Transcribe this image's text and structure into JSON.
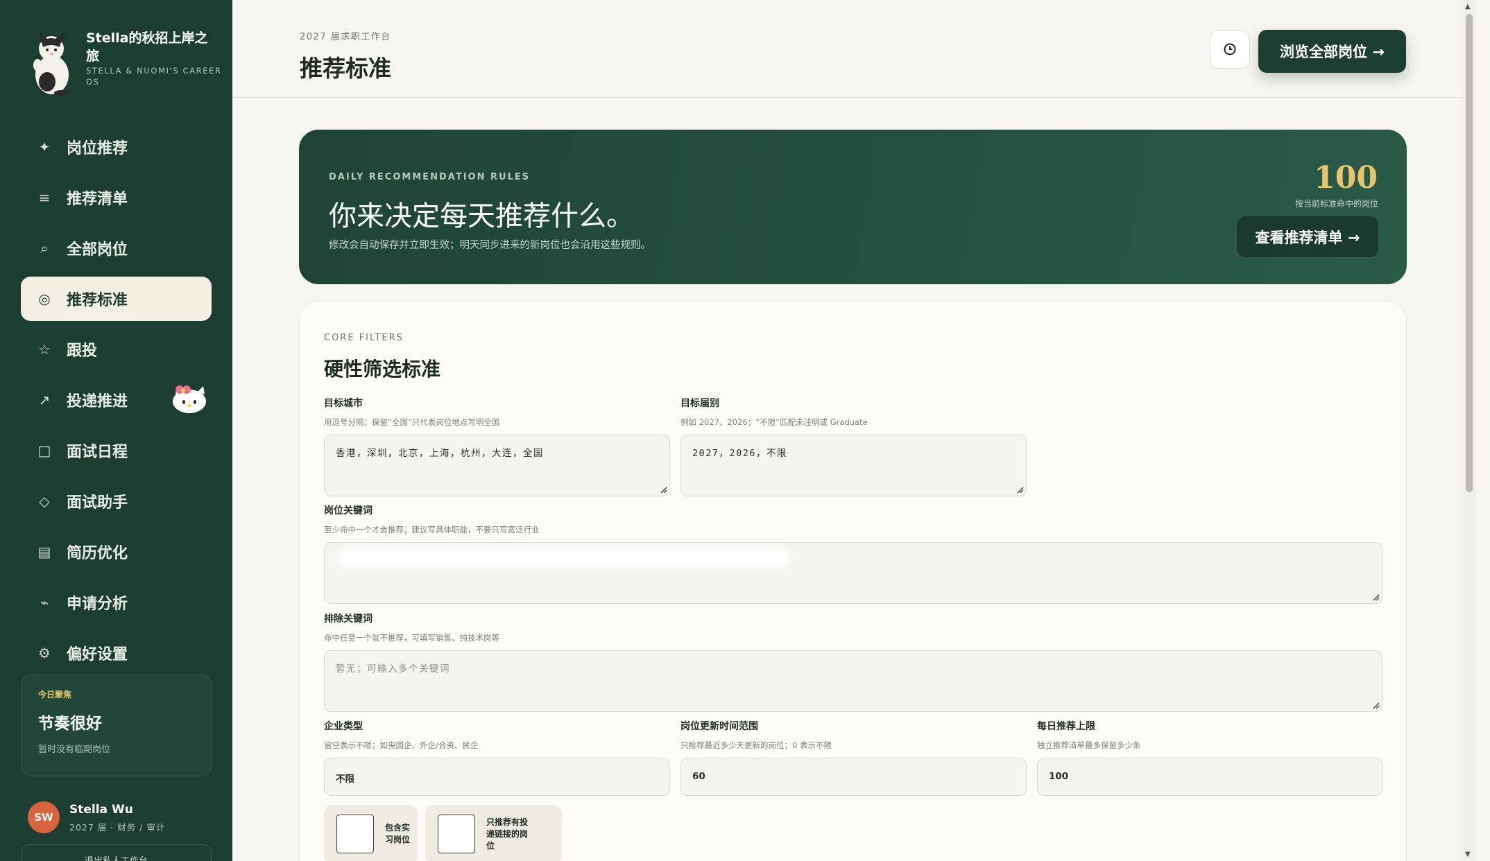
{
  "brand": {
    "title": "Stella的秋招上岸之旅",
    "subtitle": "STELLA & NUOMI'S CAREER OS"
  },
  "nav": [
    {
      "icon": "sparkle-icon",
      "glyph": "✦",
      "label": "岗位推荐"
    },
    {
      "icon": "list-icon",
      "glyph": "≡",
      "label": "推荐清单"
    },
    {
      "icon": "search-icon",
      "glyph": "⌕",
      "label": "全部岗位"
    },
    {
      "icon": "target-icon",
      "glyph": "◎",
      "label": "推荐标准"
    },
    {
      "icon": "star-icon",
      "glyph": "☆",
      "label": "跟投"
    },
    {
      "icon": "arrow-up-right-icon",
      "glyph": "↗",
      "label": "投递推进"
    },
    {
      "icon": "square-icon",
      "glyph": "□",
      "label": "面试日程"
    },
    {
      "icon": "diamond-icon",
      "glyph": "◇",
      "label": "面试助手"
    },
    {
      "icon": "document-icon",
      "glyph": "▤",
      "label": "简历优化"
    },
    {
      "icon": "trend-icon",
      "glyph": "⌁",
      "label": "申请分析"
    },
    {
      "icon": "gear-icon",
      "glyph": "⚙",
      "label": "偏好设置"
    }
  ],
  "focus": {
    "tag": "今日聚焦",
    "title": "节奏很好",
    "subtitle": "暂时没有临期岗位"
  },
  "user": {
    "initials": "SW",
    "name": "Stella Wu",
    "meta": "2027 届 · 财务 / 审计",
    "logout": "退出私人工作台"
  },
  "header": {
    "eyebrow": "2027 届求职工作台",
    "title": "推荐标准",
    "history_icon": "clock-icon",
    "browse_button": "浏览全部岗位 →"
  },
  "hero": {
    "eyebrow": "DAILY RECOMMENDATION RULES",
    "title": "你来决定每天推荐什么。",
    "description": "修改会自动保存并立即生效；明天同步进来的新岗位也会沿用这些规则。",
    "count": "100",
    "count_label": "按当前标准命中的岗位",
    "button": "查看推荐清单 →"
  },
  "filters": {
    "eyebrow": "CORE FILTERS",
    "title": "硬性筛选标准",
    "city": {
      "label": "目标城市",
      "help": "用逗号分隔；保留“全国”只代表岗位地点写明全国",
      "value": "香港，深圳，北京，上海，杭州，大连，全国"
    },
    "cohort": {
      "label": "目标届别",
      "help": "例如 2027、2026；“不限”匹配未注明或 Graduate",
      "value": "2027，2026，不限"
    },
    "keywords": {
      "label": "岗位关键词",
      "help": "至少命中一个才会推荐；建议写具体职能，不要只写宽泛行业",
      "value": ""
    },
    "exclude": {
      "label": "排除关键词",
      "help": "命中任意一个就不推荐，可填写销售、纯技术岗等",
      "placeholder": "暂无；可输入多个关键词"
    },
    "company_type": {
      "label": "企业类型",
      "help": "留空表示不限；如央国企、外企/合资、民企",
      "value": "不限"
    },
    "update_range": {
      "label": "岗位更新时间范围",
      "help": "只推荐最近多少天更新的岗位；0 表示不限",
      "value": "60"
    },
    "daily_limit": {
      "label": "每日推荐上限",
      "help": "独立推荐清单最多保留多少条",
      "value": "100"
    },
    "include_intern": {
      "label": "包含实习岗位",
      "checked": false
    },
    "only_with_link": {
      "label": "只推荐有投递链接的岗位",
      "checked": false
    }
  },
  "colors": {
    "sidebar": "#1c3d31",
    "accent_gold": "#e8c56a",
    "background": "#f7f5ef"
  }
}
